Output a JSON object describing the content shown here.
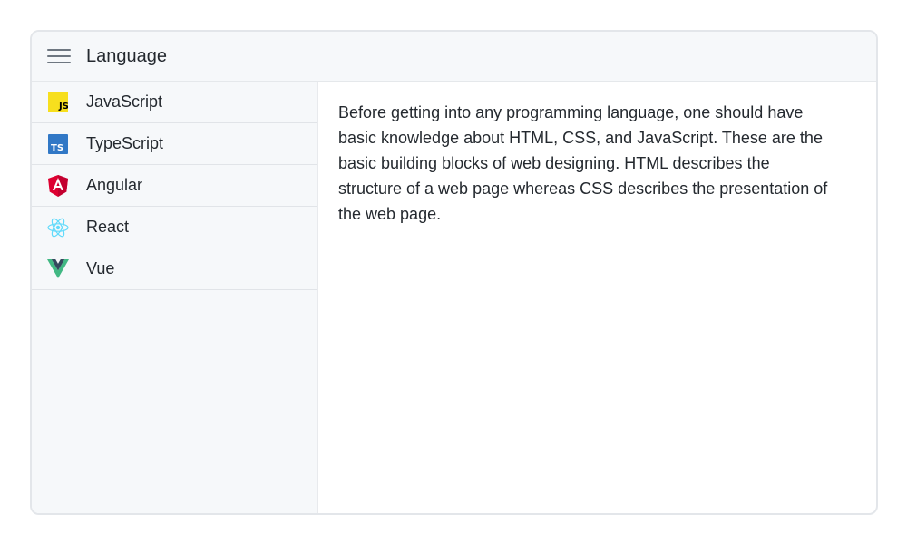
{
  "header": {
    "title": "Language",
    "menu_icon": "hamburger-menu-icon"
  },
  "sidebar": {
    "items": [
      {
        "label": "JavaScript",
        "icon": "javascript-icon"
      },
      {
        "label": "TypeScript",
        "icon": "typescript-icon"
      },
      {
        "label": "Angular",
        "icon": "angular-icon"
      },
      {
        "label": "React",
        "icon": "react-icon"
      },
      {
        "label": "Vue",
        "icon": "vue-icon"
      }
    ]
  },
  "content": {
    "text": "Before getting into any programming language, one should have basic knowledge about HTML, CSS, and JavaScript. These are the basic building blocks of web designing. HTML describes the structure of a web page whereas CSS describes the presentation of the web page."
  },
  "colors": {
    "javascript": "#f7df1e",
    "typescript": "#3178c6",
    "angular": "#dd0031",
    "react": "#61dafb",
    "vue_outer": "#41b883",
    "vue_inner": "#35495e"
  }
}
